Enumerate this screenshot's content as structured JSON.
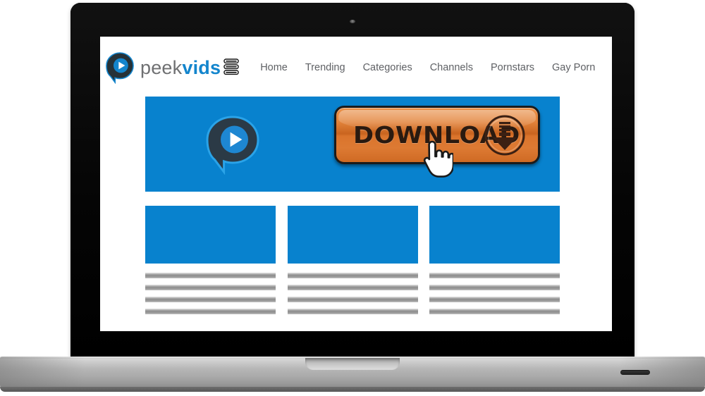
{
  "device": {
    "type": "laptop-mockup",
    "camera_icon": "webcam-dot-icon",
    "base_port_icon": "port-slot-icon",
    "trackpad_notch_icon": "lid-notch-icon",
    "colors": {
      "bezel": "#0a0a0a",
      "base": "#b6b6b6",
      "screen_background": "#ffffff"
    }
  },
  "site": {
    "brand": {
      "mark_icon": "peekvids-play-bubble-logo-icon",
      "name_part_1": "peek",
      "name_part_2": "vids",
      "stack_icon": "stacked-bars-icon",
      "colors": {
        "peek": "#6f7072",
        "vids": "#1385cd",
        "mark_dark": "#263238",
        "mark_blue": "#1385cd"
      }
    },
    "nav": {
      "items": [
        {
          "label": "Home"
        },
        {
          "label": "Trending"
        },
        {
          "label": "Categories"
        },
        {
          "label": "Channels"
        },
        {
          "label": "Pornstars"
        },
        {
          "label": "Gay Porn"
        }
      ]
    },
    "hero": {
      "background_color": "#0882ce",
      "logo_icon": "peekvids-play-bubble-logo-icon",
      "download_button": {
        "label": "DOWNLOAD",
        "arrow_icon": "circle-down-arrow-icon",
        "background_color": "#d9722e",
        "text_color": "#2a1a10",
        "border_color": "#1b1b1b"
      },
      "cursor_icon": "pointing-hand-cursor-icon"
    },
    "cards": [
      {
        "thumbnail_color": "#0882ce",
        "placeholder_lines": [
          1,
          2,
          3,
          4
        ]
      },
      {
        "thumbnail_color": "#0882ce",
        "placeholder_lines": [
          1,
          2,
          3,
          4
        ]
      },
      {
        "thumbnail_color": "#0882ce",
        "placeholder_lines": [
          1,
          2,
          3,
          4
        ]
      }
    ]
  }
}
